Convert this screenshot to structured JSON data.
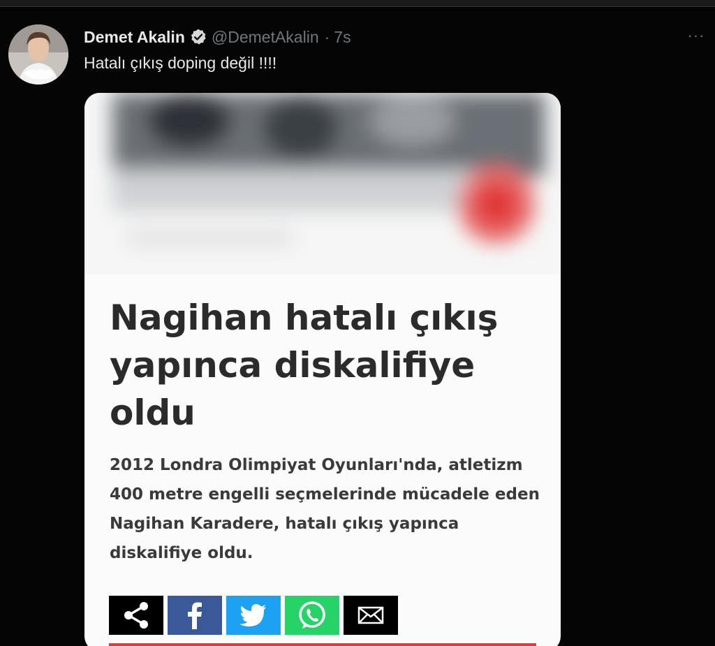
{
  "tweet": {
    "display_name": "Demet Akalin",
    "handle": "@DemetAkalin",
    "separator": "·",
    "time": "7s",
    "more_label": "···",
    "text": "Hatalı çıkış doping değil !!!!",
    "verified_icon": "verified-badge-icon"
  },
  "media": {
    "headline": "Nagihan hatalı çıkış yapınca diskalifiye oldu",
    "summary": "2012 Londra Olimpiyat Oyunları'nda, atletizm 400 metre engelli seçmelerinde mücadele eden Nagihan Karadere, hatalı çıkış yapınca diskalifiye oldu.",
    "share_buttons": [
      {
        "name": "share-icon",
        "color": "#000000"
      },
      {
        "name": "facebook-icon",
        "color": "#3b5998"
      },
      {
        "name": "twitter-icon",
        "color": "#1da1f2"
      },
      {
        "name": "whatsapp-icon",
        "color": "#25d366"
      },
      {
        "name": "mail-icon",
        "color": "#000000"
      }
    ],
    "accent_color": "#e23b3b"
  }
}
